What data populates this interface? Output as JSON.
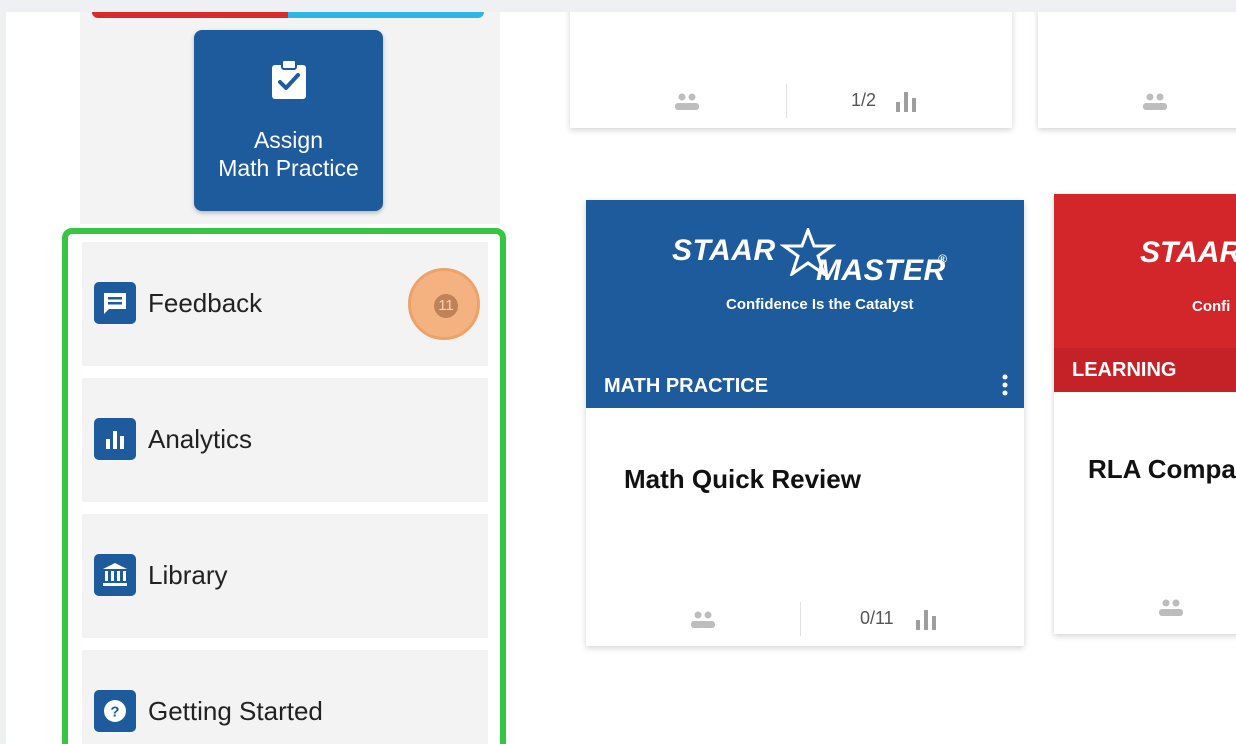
{
  "sidebar": {
    "assign_button": {
      "line1": "Assign",
      "line2": "Math Practice",
      "icon": "clipboard-check-icon"
    },
    "nav_items": [
      {
        "label": "Feedback",
        "icon": "feedback-icon",
        "badge": "11"
      },
      {
        "label": "Analytics",
        "icon": "bar-chart-icon"
      },
      {
        "label": "Library",
        "icon": "library-icon"
      },
      {
        "label": "Getting Started",
        "icon": "help-icon"
      }
    ]
  },
  "cards": {
    "top_left": {
      "stats": "1/2"
    },
    "math_card": {
      "logo_word1": "STAAR",
      "logo_word2": "MASTER",
      "registered": "®",
      "tagline": "Confidence Is the Catalyst",
      "category": "MATH PRACTICE",
      "title": "Math Quick Review",
      "stats": "0/11"
    },
    "rla_card": {
      "logo_word1": "STAAR",
      "tagline": "Confi",
      "category": "LEARNING",
      "title": "RLA Compa"
    }
  },
  "colors": {
    "brand_blue": "#1e5b9c",
    "brand_red": "#d3262a",
    "highlight_green": "#36c642",
    "badge_orange": "#f3b27f"
  }
}
